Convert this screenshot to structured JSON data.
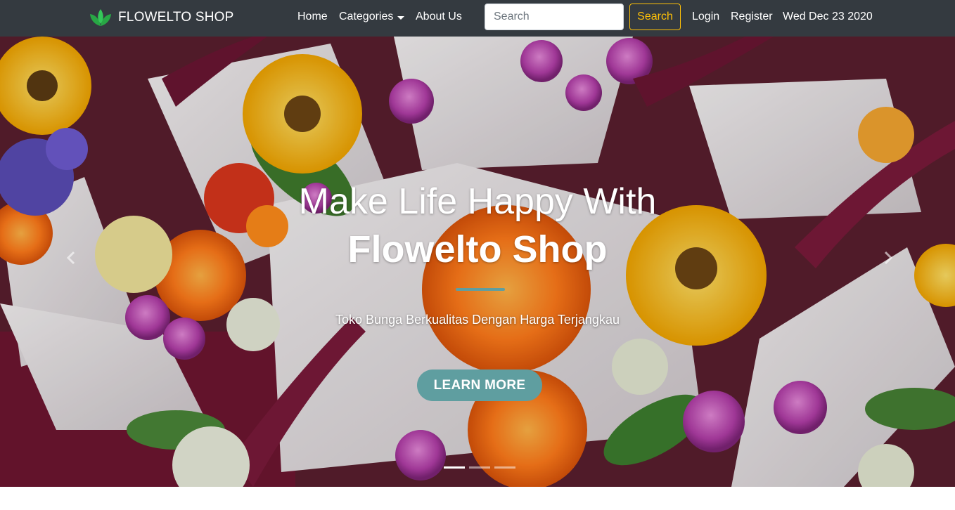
{
  "navbar": {
    "brand": "FLOWELTO SHOP",
    "brand_icon": "leaf-logo-icon",
    "links": {
      "home": "Home",
      "categories": "Categories",
      "about": "About Us",
      "login": "Login",
      "register": "Register"
    },
    "search": {
      "placeholder": "Search",
      "button_label": "Search"
    },
    "date": "Wed Dec 23 2020"
  },
  "hero": {
    "title_line1": "Make Life Happy With",
    "title_line2": "Flowelto Shop",
    "subtitle": "Toko Bunga Berkualitas Dengan Harga Terjangkau",
    "cta_label": "LEARN MORE",
    "slides_count": 3,
    "active_slide": 1
  },
  "colors": {
    "navbar_bg": "#343a40",
    "accent_yellow": "#ffc107",
    "cta_teal": "#5f9ea0",
    "logo_green": "#28a745"
  }
}
